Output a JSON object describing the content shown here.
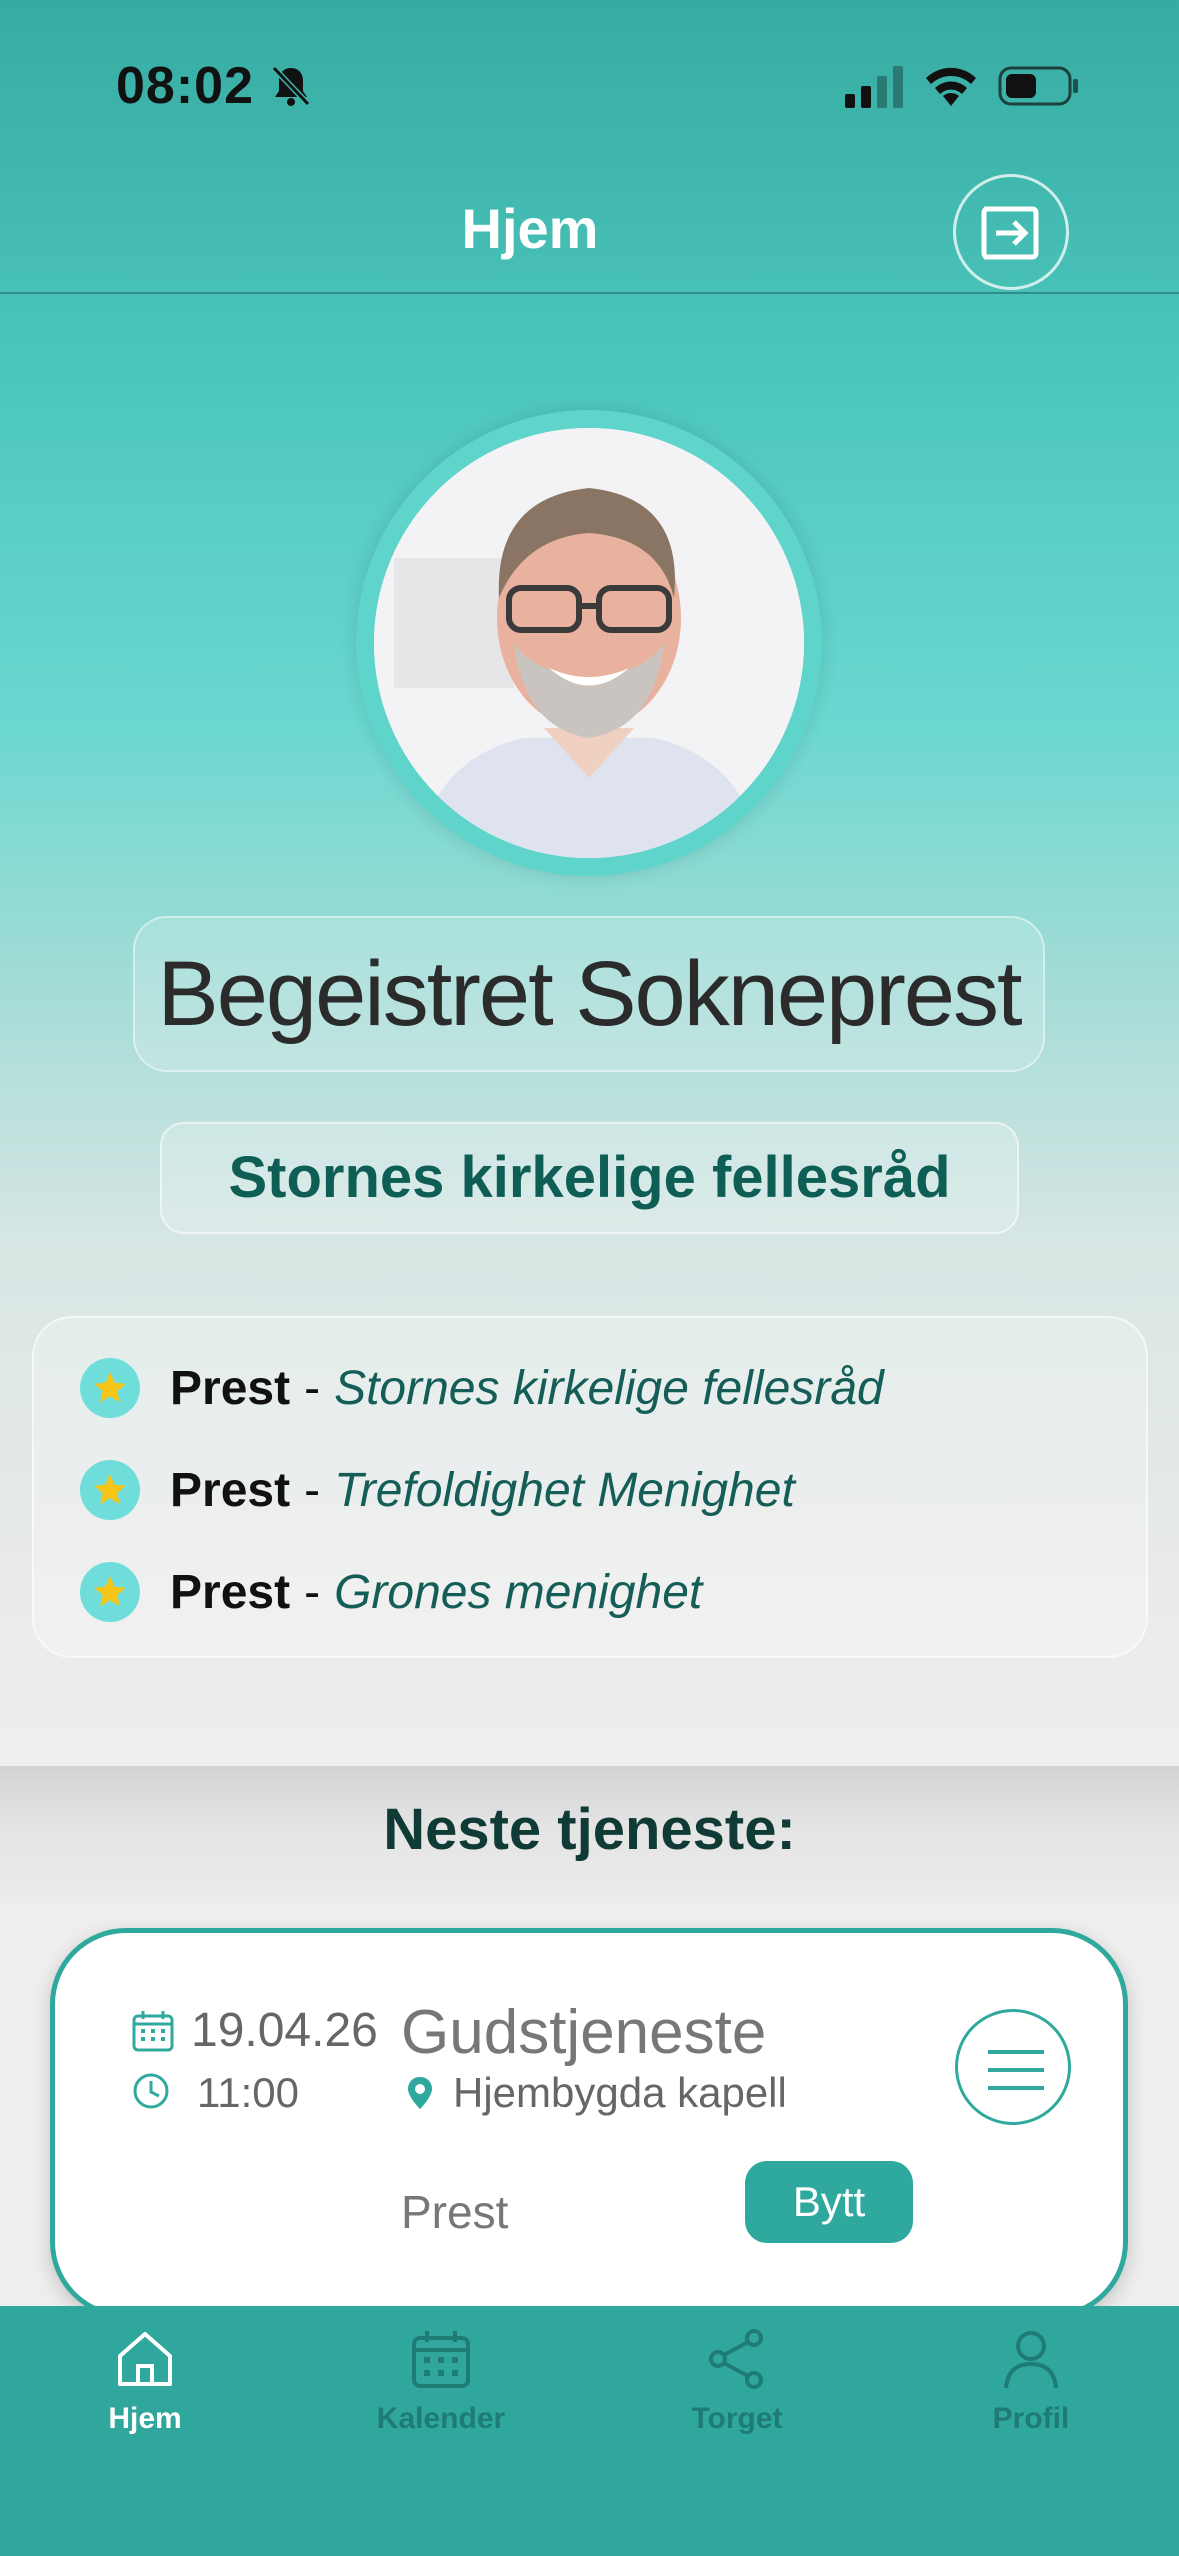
{
  "status_bar": {
    "time": "08:02"
  },
  "header": {
    "title": "Hjem"
  },
  "profile": {
    "name": "Begeistret Sokneprest",
    "organization": "Stornes kirkelige fellesråd"
  },
  "roles": [
    {
      "title": "Prest",
      "separator": "-",
      "org": "Stornes kirkelige fellesråd"
    },
    {
      "title": "Prest",
      "separator": "-",
      "org": "Trefoldighet Menighet"
    },
    {
      "title": "Prest",
      "separator": "-",
      "org": "Grones menighet"
    }
  ],
  "next_service": {
    "heading": "Neste tjeneste:",
    "date": "19.04.26",
    "time": "11:00",
    "name": "Gudstjeneste",
    "location": "Hjembygda kapell",
    "role": "Prest",
    "swap_label": "Bytt"
  },
  "tabs": [
    {
      "label": "Hjem",
      "active": true
    },
    {
      "label": "Kalender",
      "active": false
    },
    {
      "label": "Torget",
      "active": false
    },
    {
      "label": "Profil",
      "active": false
    }
  ],
  "colors": {
    "accent": "#30a79d",
    "org_text": "#0e5e55",
    "star": "#f5c518"
  }
}
